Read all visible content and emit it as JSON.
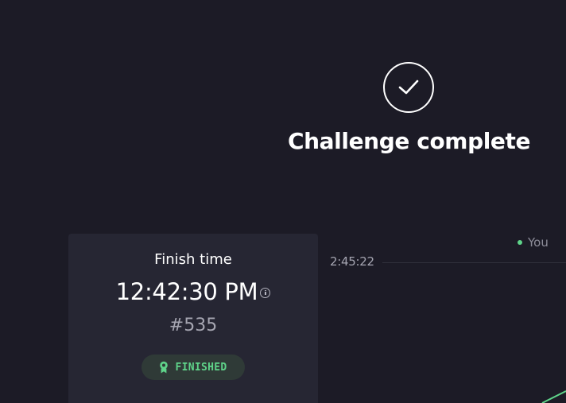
{
  "header": {
    "title": "Challenge complete",
    "status_icon": "checkmark-circle-icon"
  },
  "card": {
    "label": "Finish time",
    "time": "12:42:30 PM",
    "rank": "#535",
    "info_icon": "info-icon",
    "badge": {
      "label": "FINISHED",
      "icon": "medal-icon",
      "color": "#5fd48a"
    }
  },
  "chart": {
    "legend": {
      "label": "You",
      "color": "#5fd48a"
    },
    "y_tick": "2:45:22"
  },
  "colors": {
    "background": "#1c1b26",
    "card": "#262633",
    "accent": "#5fd48a",
    "muted_text": "#a6a6b2"
  }
}
